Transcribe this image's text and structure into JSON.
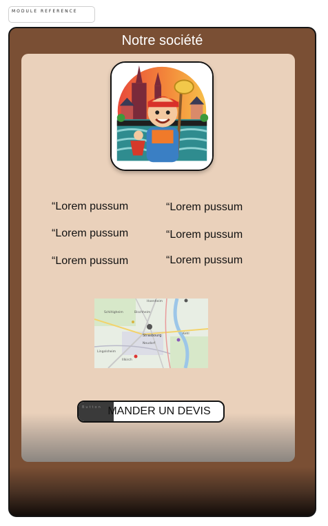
{
  "module_ref": {
    "label": "MODULE REFERENCE"
  },
  "frame": {
    "title": "Notre société"
  },
  "logo": {
    "icon": "cleaning-mascot-logo"
  },
  "features": {
    "left": [
      "“Lorem pussum",
      "“Lorem pussum",
      "“Lorem pussum"
    ],
    "right": [
      "“Lorem pussum",
      "“Lorem pussum",
      "“Lorem pussum"
    ]
  },
  "map": {
    "icon": "location-map",
    "labels": [
      "Hoenheim",
      "Bischheim",
      "Schiltigheim",
      "Strasbourg",
      "Neudorf",
      "Lingolsheim",
      "Illkirch",
      "Kehl"
    ]
  },
  "cta": {
    "label": "MANDER UN DEVIS",
    "badge": "Button"
  },
  "colors": {
    "frame_brown": "#7a4f34",
    "panel_beige": "#ead1bb",
    "title_text": "#ffffff"
  }
}
